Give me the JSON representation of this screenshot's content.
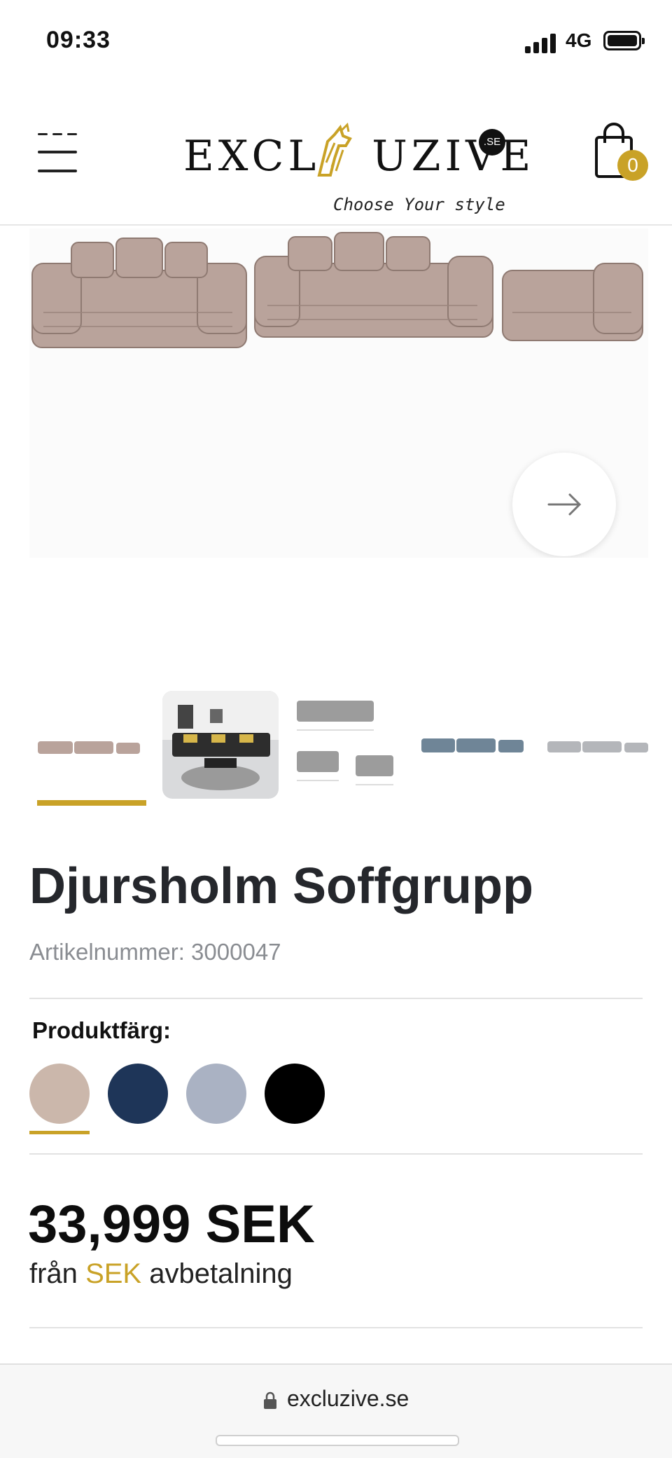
{
  "status_bar": {
    "time": "09:33",
    "network": "4G"
  },
  "header": {
    "logo_text": "EXCLUZIVE",
    "logo_tld": ".SE",
    "logo_tagline": "Choose Your style",
    "cart_count": "0"
  },
  "product": {
    "title": "Djursholm Soffgrupp",
    "sku": "Artikelnummer: 3000047",
    "color_label": "Produktfärg:",
    "colors": [
      "#cbb7ab",
      "#1e3558",
      "#aab2c3",
      "#000000"
    ],
    "selected_color_index": 0,
    "price": "33,999 SEK",
    "installment_prefix": "från",
    "installment_currency": "SEK",
    "installment_suffix": "avbetalning"
  },
  "gallery": {
    "thumbnail_count": 5,
    "active_thumbnail": 0
  },
  "browser": {
    "url": "excluzive.se"
  },
  "colors": {
    "accent": "#c9a227",
    "text": "#25272c",
    "muted": "#8a8d92"
  }
}
